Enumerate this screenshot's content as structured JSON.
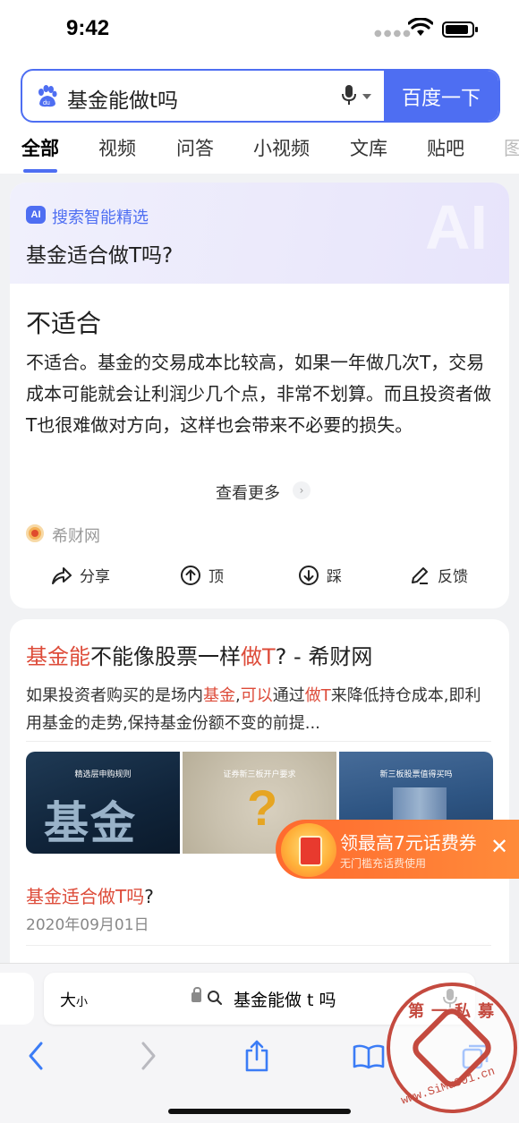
{
  "status": {
    "time": "9:42"
  },
  "search": {
    "query": "基金能做t吗",
    "button": "百度一下"
  },
  "tabs": [
    {
      "label": "全部"
    },
    {
      "label": "视频"
    },
    {
      "label": "问答"
    },
    {
      "label": "小视频"
    },
    {
      "label": "文库"
    },
    {
      "label": "贴吧"
    },
    {
      "label": "图"
    }
  ],
  "ai_card": {
    "badge": "AI",
    "label": "搜索智能精选",
    "question": "基金适合做T吗?",
    "answer_title": "不适合",
    "answer_body": "不适合。基金的交易成本比较高，如果一年做几次T，交易成本可能就会让利润少几个点，非常不划算。而且投资者做T也很难做对方向，这样也会带来不必要的损失。",
    "more": "查看更多",
    "source": "希财网",
    "actions": [
      "分享",
      "顶",
      "踩",
      "反馈"
    ]
  },
  "result": {
    "title_parts": [
      "基金能",
      "不能像股票一样",
      "做T",
      "? - 希财网"
    ],
    "desc_parts": [
      "如果投资者购买的是场内",
      "基金",
      ",",
      "可以",
      "通过",
      "做T",
      "来降低持仓成本,即利用基金的走势,保持基金份额不变的前提..."
    ],
    "thumbs": [
      {
        "caption": "精选层申购规则",
        "big_text": "基金"
      },
      {
        "caption": "证券新三板开户要求"
      },
      {
        "caption": "新三板股票值得买吗"
      }
    ],
    "sub_hl": "基金适合做T吗",
    "sub_tail": "?",
    "date": "2020年09月01日"
  },
  "promo": {
    "title": "领最高7元话费券",
    "subtitle": "无门槛充话费使用"
  },
  "browser": {
    "text_size_big": "大",
    "text_size_small": "小",
    "url": "基金能做 t 吗"
  },
  "watermark": {
    "top": "第一私募",
    "bottom": "www.SiMu001.cn"
  },
  "colors": {
    "accent": "#4e6ef2",
    "highlight": "#dd4b39",
    "promo": "#ff7a33"
  }
}
